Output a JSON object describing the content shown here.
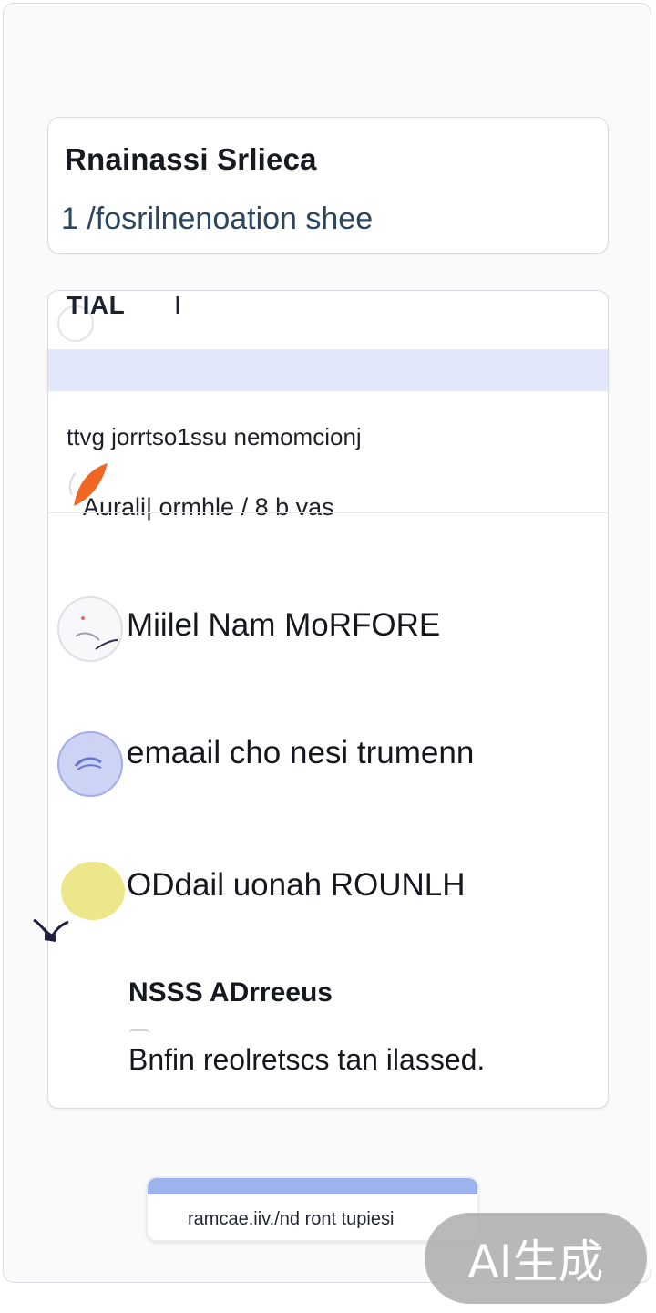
{
  "header": {
    "title": "Rnainassi Srlieca",
    "subtitle": "1 /fosrilnenoation shee"
  },
  "tab": {
    "label": "TIAL",
    "divider": "I"
  },
  "note": {
    "text": "ttvg jorrtso1ssu nemomcionj",
    "meta": "Aurali| ormhle / 8 b vas"
  },
  "features": [
    {
      "label": "Miilel Nam MoRFORE",
      "icon": "avatar-icon"
    },
    {
      "label": "emaail cho nesi trumenn",
      "icon": "hand-icon"
    },
    {
      "label": "ODdail uonah ROUNLH",
      "icon": "spot-icon"
    }
  ],
  "address": {
    "title": "NSSS ADrreeus",
    "body": "Bnfin reolretscs tan ilassed."
  },
  "cta": {
    "label": "ramcae.iiv./nd ront tupiesi"
  },
  "watermark": {
    "text": "AI生成"
  },
  "colors": {
    "band": "#e2e8fa",
    "accent": "#f06723",
    "cta_bar": "#9cb3ee"
  }
}
